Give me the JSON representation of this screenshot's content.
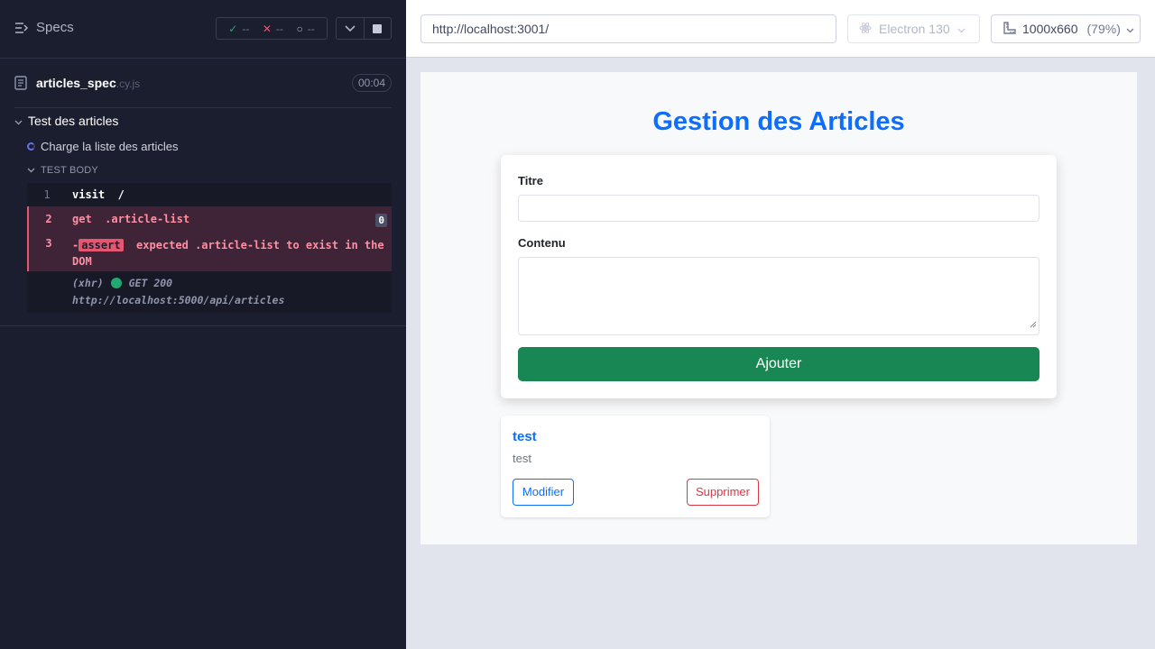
{
  "reporter": {
    "specs_label": "Specs",
    "stats": {
      "passed": "--",
      "failed": "--",
      "pending": "--"
    },
    "spec": {
      "name": "articles_spec",
      "ext": ".cy.js",
      "duration": "00:04"
    },
    "suite_title": "Test des articles",
    "test_title": "Charge la liste des articles",
    "test_body_label": "TEST BODY",
    "commands": [
      {
        "num": "1",
        "name": "visit",
        "message": "/"
      },
      {
        "num": "2",
        "name": "get",
        "message": ".article-list",
        "badge": "0"
      },
      {
        "num": "3",
        "prefix": "-",
        "tag": "assert",
        "message": "expected .article-list to exist in the DOM"
      }
    ],
    "xhr": {
      "type": "(xhr)",
      "method_status": "GET 200",
      "url": "http://localhost:5000/api/articles"
    }
  },
  "toolbar": {
    "url": "http://localhost:3001/",
    "browser": "Electron 130",
    "viewport": "1000x660",
    "zoom": "(79%)"
  },
  "app": {
    "title": "Gestion des Articles",
    "form": {
      "title_label": "Titre",
      "content_label": "Contenu",
      "submit_label": "Ajouter"
    },
    "articles": [
      {
        "title": "test",
        "content": "test",
        "edit_label": "Modifier",
        "delete_label": "Supprimer"
      }
    ]
  },
  "colors": {
    "accent_blue": "#0d6efd",
    "success_green": "#198754",
    "danger_red": "#dc3545",
    "cypress_fail": "#e45770",
    "cypress_pass": "#1fa971"
  }
}
